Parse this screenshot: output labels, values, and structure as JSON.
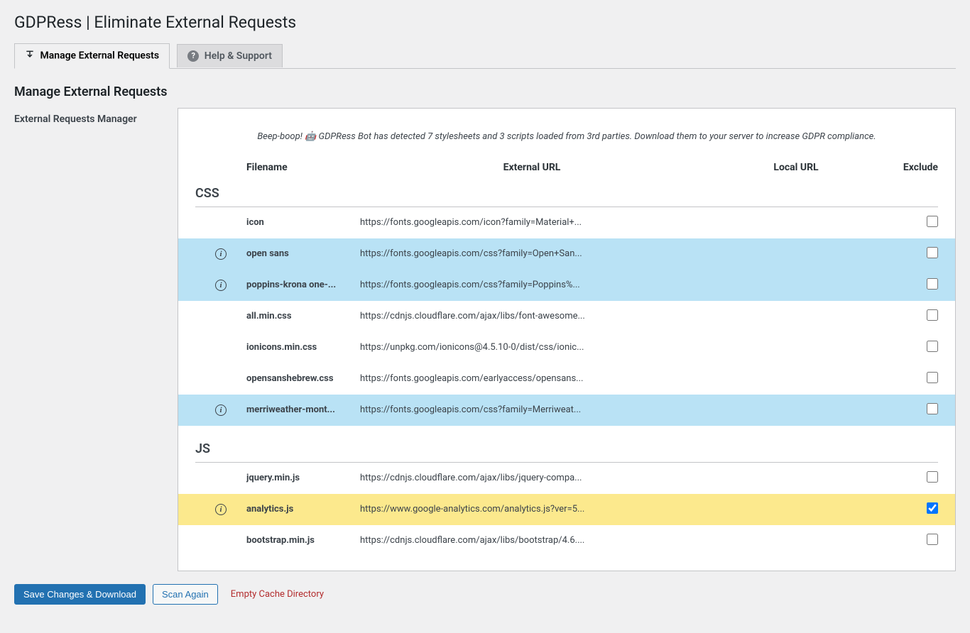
{
  "page_title": "GDPRess | Eliminate External Requests",
  "tabs": [
    {
      "label": "Manage External Requests",
      "active": true
    },
    {
      "label": "Help & Support",
      "active": false
    }
  ],
  "section_title": "Manage External Requests",
  "sidebar_label": "External Requests Manager",
  "intro_text": "Beep-boop! 🤖 GDPRess Bot has detected 7 stylesheets and 3 scripts loaded from 3rd parties. Download them to your server to increase GDPR compliance.",
  "columns": {
    "filename": "Filename",
    "external_url": "External URL",
    "local_url": "Local URL",
    "exclude": "Exclude"
  },
  "groups": [
    {
      "title": "CSS",
      "rows": [
        {
          "has_info": false,
          "filename": "icon",
          "external_url": "https://fonts.googleapis.com/icon?family=Material+...",
          "local_url": "",
          "exclude": false,
          "highlight": ""
        },
        {
          "has_info": true,
          "filename": "open sans",
          "external_url": "https://fonts.googleapis.com/css?family=Open+San...",
          "local_url": "",
          "exclude": false,
          "highlight": "blue"
        },
        {
          "has_info": true,
          "filename": "poppins-krona one-...",
          "external_url": "https://fonts.googleapis.com/css?family=Poppins%...",
          "local_url": "",
          "exclude": false,
          "highlight": "blue"
        },
        {
          "has_info": false,
          "filename": "all.min.css",
          "external_url": "https://cdnjs.cloudflare.com/ajax/libs/font-awesome...",
          "local_url": "",
          "exclude": false,
          "highlight": ""
        },
        {
          "has_info": false,
          "filename": "ionicons.min.css",
          "external_url": "https://unpkg.com/ionicons@4.5.10-0/dist/css/ionic...",
          "local_url": "",
          "exclude": false,
          "highlight": ""
        },
        {
          "has_info": false,
          "filename": "opensanshebrew.css",
          "external_url": "https://fonts.googleapis.com/earlyaccess/opensans...",
          "local_url": "",
          "exclude": false,
          "highlight": ""
        },
        {
          "has_info": true,
          "filename": "merriweather-mont...",
          "external_url": "https://fonts.googleapis.com/css?family=Merriweat...",
          "local_url": "",
          "exclude": false,
          "highlight": "blue"
        }
      ]
    },
    {
      "title": "JS",
      "rows": [
        {
          "has_info": false,
          "filename": "jquery.min.js",
          "external_url": "https://cdnjs.cloudflare.com/ajax/libs/jquery-compa...",
          "local_url": "",
          "exclude": false,
          "highlight": ""
        },
        {
          "has_info": true,
          "filename": "analytics.js",
          "external_url": "https://www.google-analytics.com/analytics.js?ver=5...",
          "local_url": "",
          "exclude": true,
          "highlight": "yellow"
        },
        {
          "has_info": false,
          "filename": "bootstrap.min.js",
          "external_url": "https://cdnjs.cloudflare.com/ajax/libs/bootstrap/4.6....",
          "local_url": "",
          "exclude": false,
          "highlight": ""
        }
      ]
    }
  ],
  "actions": {
    "save": "Save Changes & Download",
    "scan": "Scan Again",
    "empty": "Empty Cache Directory"
  }
}
